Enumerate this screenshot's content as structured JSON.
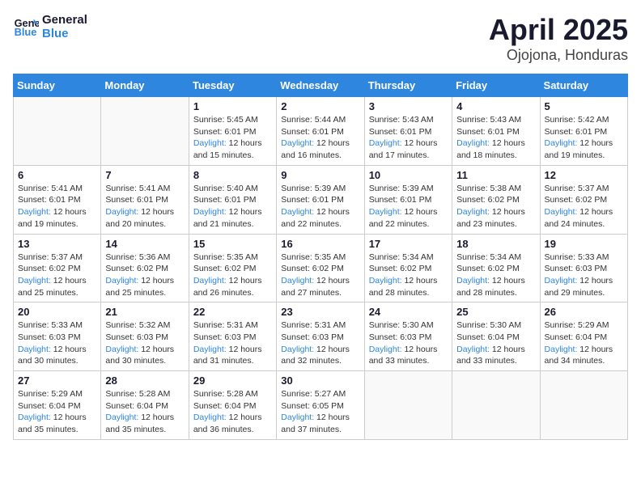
{
  "header": {
    "logo_line1": "General",
    "logo_line2": "Blue",
    "month_year": "April 2025",
    "location": "Ojojona, Honduras"
  },
  "weekdays": [
    "Sunday",
    "Monday",
    "Tuesday",
    "Wednesday",
    "Thursday",
    "Friday",
    "Saturday"
  ],
  "weeks": [
    [
      {
        "day": "",
        "sunrise": "",
        "sunset": "",
        "daylight": ""
      },
      {
        "day": "",
        "sunrise": "",
        "sunset": "",
        "daylight": ""
      },
      {
        "day": "1",
        "sunrise": "Sunrise: 5:45 AM",
        "sunset": "Sunset: 6:01 PM",
        "daylight": "Daylight: 12 hours and 15 minutes."
      },
      {
        "day": "2",
        "sunrise": "Sunrise: 5:44 AM",
        "sunset": "Sunset: 6:01 PM",
        "daylight": "Daylight: 12 hours and 16 minutes."
      },
      {
        "day": "3",
        "sunrise": "Sunrise: 5:43 AM",
        "sunset": "Sunset: 6:01 PM",
        "daylight": "Daylight: 12 hours and 17 minutes."
      },
      {
        "day": "4",
        "sunrise": "Sunrise: 5:43 AM",
        "sunset": "Sunset: 6:01 PM",
        "daylight": "Daylight: 12 hours and 18 minutes."
      },
      {
        "day": "5",
        "sunrise": "Sunrise: 5:42 AM",
        "sunset": "Sunset: 6:01 PM",
        "daylight": "Daylight: 12 hours and 19 minutes."
      }
    ],
    [
      {
        "day": "6",
        "sunrise": "Sunrise: 5:41 AM",
        "sunset": "Sunset: 6:01 PM",
        "daylight": "Daylight: 12 hours and 19 minutes."
      },
      {
        "day": "7",
        "sunrise": "Sunrise: 5:41 AM",
        "sunset": "Sunset: 6:01 PM",
        "daylight": "Daylight: 12 hours and 20 minutes."
      },
      {
        "day": "8",
        "sunrise": "Sunrise: 5:40 AM",
        "sunset": "Sunset: 6:01 PM",
        "daylight": "Daylight: 12 hours and 21 minutes."
      },
      {
        "day": "9",
        "sunrise": "Sunrise: 5:39 AM",
        "sunset": "Sunset: 6:01 PM",
        "daylight": "Daylight: 12 hours and 22 minutes."
      },
      {
        "day": "10",
        "sunrise": "Sunrise: 5:39 AM",
        "sunset": "Sunset: 6:01 PM",
        "daylight": "Daylight: 12 hours and 22 minutes."
      },
      {
        "day": "11",
        "sunrise": "Sunrise: 5:38 AM",
        "sunset": "Sunset: 6:02 PM",
        "daylight": "Daylight: 12 hours and 23 minutes."
      },
      {
        "day": "12",
        "sunrise": "Sunrise: 5:37 AM",
        "sunset": "Sunset: 6:02 PM",
        "daylight": "Daylight: 12 hours and 24 minutes."
      }
    ],
    [
      {
        "day": "13",
        "sunrise": "Sunrise: 5:37 AM",
        "sunset": "Sunset: 6:02 PM",
        "daylight": "Daylight: 12 hours and 25 minutes."
      },
      {
        "day": "14",
        "sunrise": "Sunrise: 5:36 AM",
        "sunset": "Sunset: 6:02 PM",
        "daylight": "Daylight: 12 hours and 25 minutes."
      },
      {
        "day": "15",
        "sunrise": "Sunrise: 5:35 AM",
        "sunset": "Sunset: 6:02 PM",
        "daylight": "Daylight: 12 hours and 26 minutes."
      },
      {
        "day": "16",
        "sunrise": "Sunrise: 5:35 AM",
        "sunset": "Sunset: 6:02 PM",
        "daylight": "Daylight: 12 hours and 27 minutes."
      },
      {
        "day": "17",
        "sunrise": "Sunrise: 5:34 AM",
        "sunset": "Sunset: 6:02 PM",
        "daylight": "Daylight: 12 hours and 28 minutes."
      },
      {
        "day": "18",
        "sunrise": "Sunrise: 5:34 AM",
        "sunset": "Sunset: 6:02 PM",
        "daylight": "Daylight: 12 hours and 28 minutes."
      },
      {
        "day": "19",
        "sunrise": "Sunrise: 5:33 AM",
        "sunset": "Sunset: 6:03 PM",
        "daylight": "Daylight: 12 hours and 29 minutes."
      }
    ],
    [
      {
        "day": "20",
        "sunrise": "Sunrise: 5:33 AM",
        "sunset": "Sunset: 6:03 PM",
        "daylight": "Daylight: 12 hours and 30 minutes."
      },
      {
        "day": "21",
        "sunrise": "Sunrise: 5:32 AM",
        "sunset": "Sunset: 6:03 PM",
        "daylight": "Daylight: 12 hours and 30 minutes."
      },
      {
        "day": "22",
        "sunrise": "Sunrise: 5:31 AM",
        "sunset": "Sunset: 6:03 PM",
        "daylight": "Daylight: 12 hours and 31 minutes."
      },
      {
        "day": "23",
        "sunrise": "Sunrise: 5:31 AM",
        "sunset": "Sunset: 6:03 PM",
        "daylight": "Daylight: 12 hours and 32 minutes."
      },
      {
        "day": "24",
        "sunrise": "Sunrise: 5:30 AM",
        "sunset": "Sunset: 6:03 PM",
        "daylight": "Daylight: 12 hours and 33 minutes."
      },
      {
        "day": "25",
        "sunrise": "Sunrise: 5:30 AM",
        "sunset": "Sunset: 6:04 PM",
        "daylight": "Daylight: 12 hours and 33 minutes."
      },
      {
        "day": "26",
        "sunrise": "Sunrise: 5:29 AM",
        "sunset": "Sunset: 6:04 PM",
        "daylight": "Daylight: 12 hours and 34 minutes."
      }
    ],
    [
      {
        "day": "27",
        "sunrise": "Sunrise: 5:29 AM",
        "sunset": "Sunset: 6:04 PM",
        "daylight": "Daylight: 12 hours and 35 minutes."
      },
      {
        "day": "28",
        "sunrise": "Sunrise: 5:28 AM",
        "sunset": "Sunset: 6:04 PM",
        "daylight": "Daylight: 12 hours and 35 minutes."
      },
      {
        "day": "29",
        "sunrise": "Sunrise: 5:28 AM",
        "sunset": "Sunset: 6:04 PM",
        "daylight": "Daylight: 12 hours and 36 minutes."
      },
      {
        "day": "30",
        "sunrise": "Sunrise: 5:27 AM",
        "sunset": "Sunset: 6:05 PM",
        "daylight": "Daylight: 12 hours and 37 minutes."
      },
      {
        "day": "",
        "sunrise": "",
        "sunset": "",
        "daylight": ""
      },
      {
        "day": "",
        "sunrise": "",
        "sunset": "",
        "daylight": ""
      },
      {
        "day": "",
        "sunrise": "",
        "sunset": "",
        "daylight": ""
      }
    ]
  ]
}
